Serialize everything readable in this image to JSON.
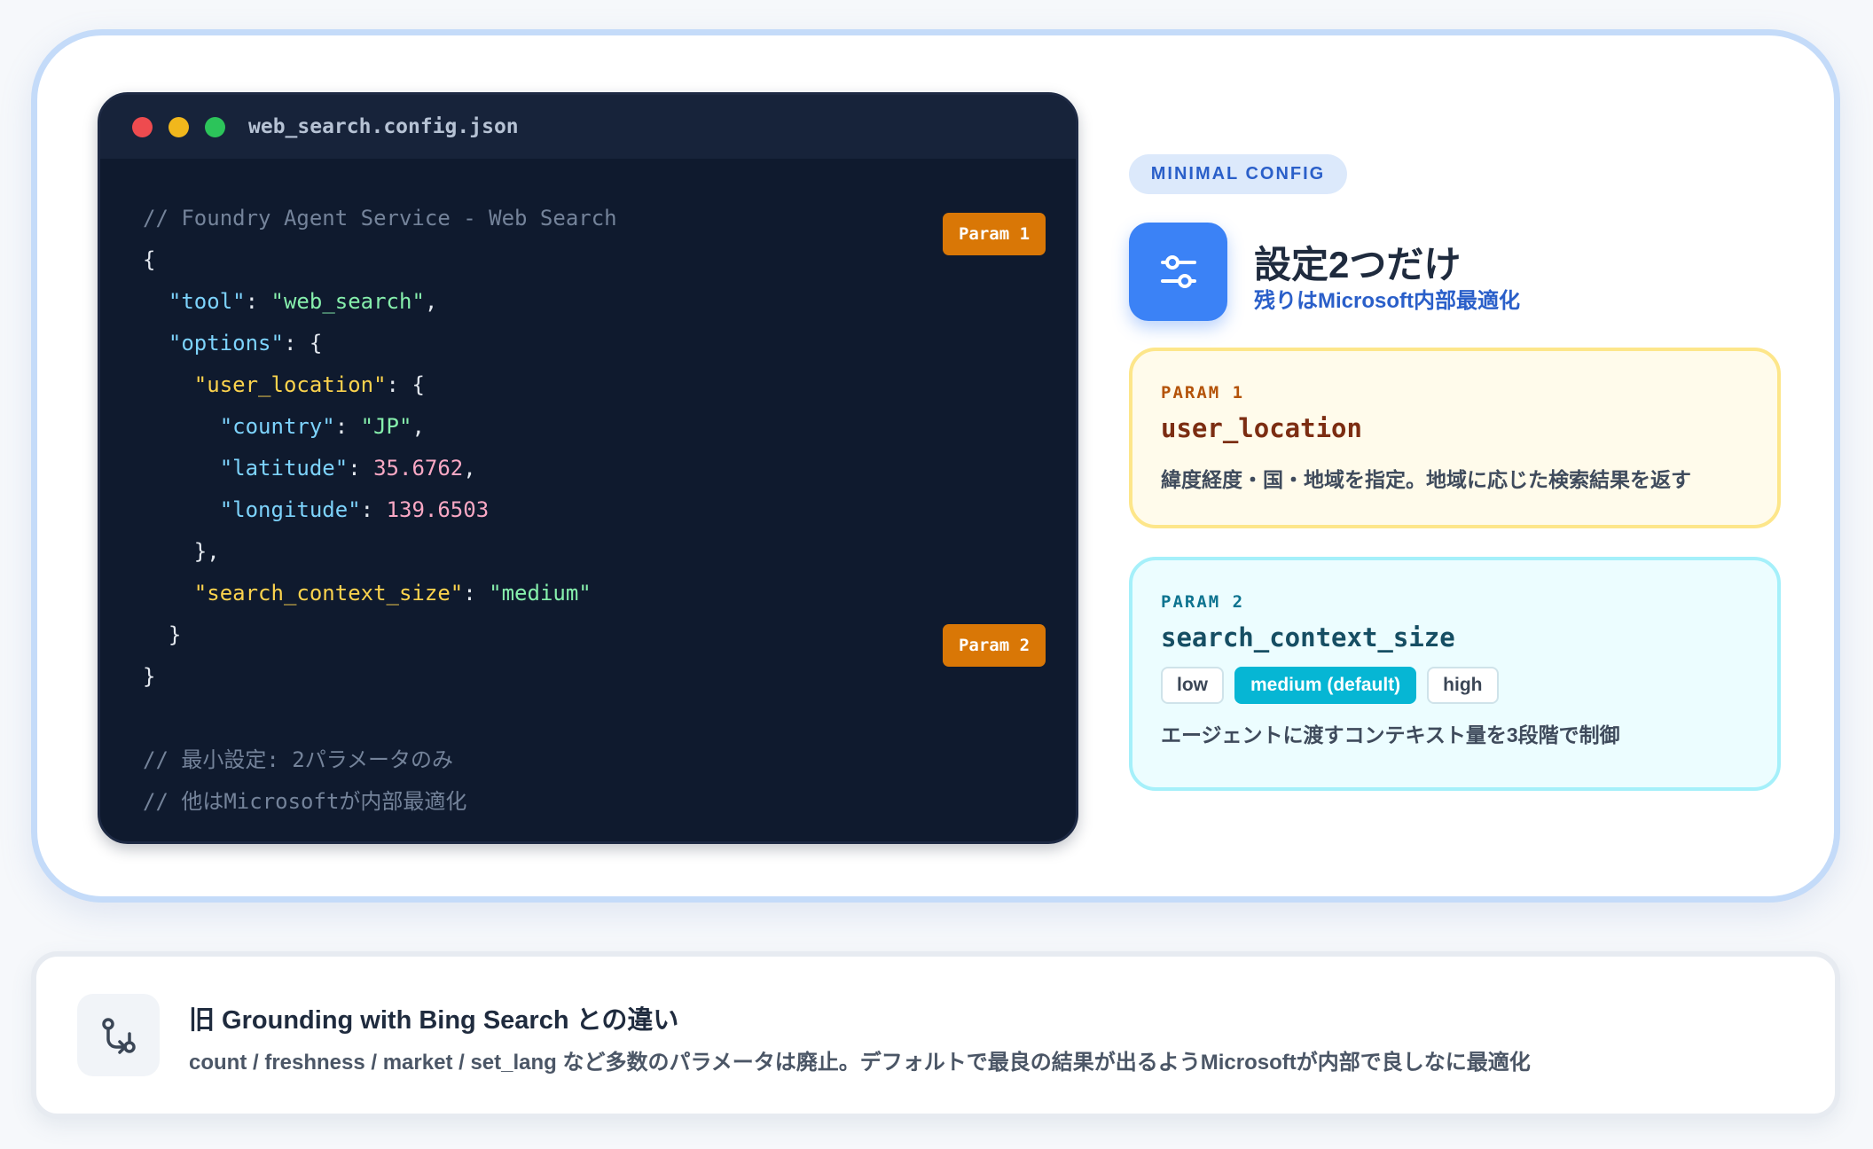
{
  "editor": {
    "filename": "web_search.config.json",
    "lines": [
      [
        {
          "c": "comment",
          "t": "// Foundry Agent Service - Web Search"
        }
      ],
      [
        {
          "c": "punct",
          "t": "{"
        }
      ],
      [
        {
          "c": "punct",
          "t": "  "
        },
        {
          "c": "key-l1",
          "t": "\"tool\""
        },
        {
          "c": "punct",
          "t": ": "
        },
        {
          "c": "str",
          "t": "\"web_search\""
        },
        {
          "c": "punct",
          "t": ","
        }
      ],
      [
        {
          "c": "punct",
          "t": "  "
        },
        {
          "c": "key-l1",
          "t": "\"options\""
        },
        {
          "c": "punct",
          "t": ": {"
        }
      ],
      [
        {
          "c": "punct",
          "t": "    "
        },
        {
          "c": "key-l2",
          "t": "\"user_location\""
        },
        {
          "c": "punct",
          "t": ": {"
        }
      ],
      [
        {
          "c": "punct",
          "t": "      "
        },
        {
          "c": "key-l3",
          "t": "\"country\""
        },
        {
          "c": "punct",
          "t": ": "
        },
        {
          "c": "str",
          "t": "\"JP\""
        },
        {
          "c": "punct",
          "t": ","
        }
      ],
      [
        {
          "c": "punct",
          "t": "      "
        },
        {
          "c": "key-l3",
          "t": "\"latitude\""
        },
        {
          "c": "punct",
          "t": ": "
        },
        {
          "c": "num",
          "t": "35.6762"
        },
        {
          "c": "punct",
          "t": ","
        }
      ],
      [
        {
          "c": "punct",
          "t": "      "
        },
        {
          "c": "key-l3",
          "t": "\"longitude\""
        },
        {
          "c": "punct",
          "t": ": "
        },
        {
          "c": "num",
          "t": "139.6503"
        }
      ],
      [
        {
          "c": "punct",
          "t": "    },"
        }
      ],
      [
        {
          "c": "punct",
          "t": "    "
        },
        {
          "c": "key-l2",
          "t": "\"search_context_size\""
        },
        {
          "c": "punct",
          "t": ": "
        },
        {
          "c": "str",
          "t": "\"medium\""
        }
      ],
      [
        {
          "c": "punct",
          "t": "  }"
        }
      ],
      [
        {
          "c": "punct",
          "t": "}"
        }
      ],
      [
        {
          "c": "punct",
          "t": " "
        }
      ],
      [
        {
          "c": "comment",
          "t": "// 最小設定: 2パラメータのみ"
        }
      ],
      [
        {
          "c": "comment",
          "t": "// 他はMicrosoftが内部最適化"
        }
      ]
    ],
    "badge1": "Param 1",
    "badge2": "Param 2"
  },
  "summary": {
    "pill": "MINIMAL CONFIG",
    "title": "設定2つだけ",
    "subtitle": "残りはMicrosoft内部最適化",
    "icon": "sliders-icon"
  },
  "param1": {
    "label": "PARAM 1",
    "name": "user_location",
    "desc": "緯度経度・国・地域を指定。地域に応じた検索結果を返す"
  },
  "param2": {
    "label": "PARAM 2",
    "name": "search_context_size",
    "options": [
      "low",
      "medium (default)",
      "high"
    ],
    "active": "medium (default)",
    "desc": "エージェントに渡すコンテキスト量を3段階で制御"
  },
  "note": {
    "icon": "git-compare-icon",
    "title": "旧 Grounding with Bing Search との違い",
    "body": "count / freshness / market / set_lang など多数のパラメータは廃止。デフォルトで最良の結果が出るようMicrosoftが内部で良しなに最適化"
  },
  "colors": {
    "accent": "#3b82f6",
    "param_badge": "#d97706",
    "editor_bg": "#0f1a2e",
    "cyan": "#06b6d4"
  }
}
